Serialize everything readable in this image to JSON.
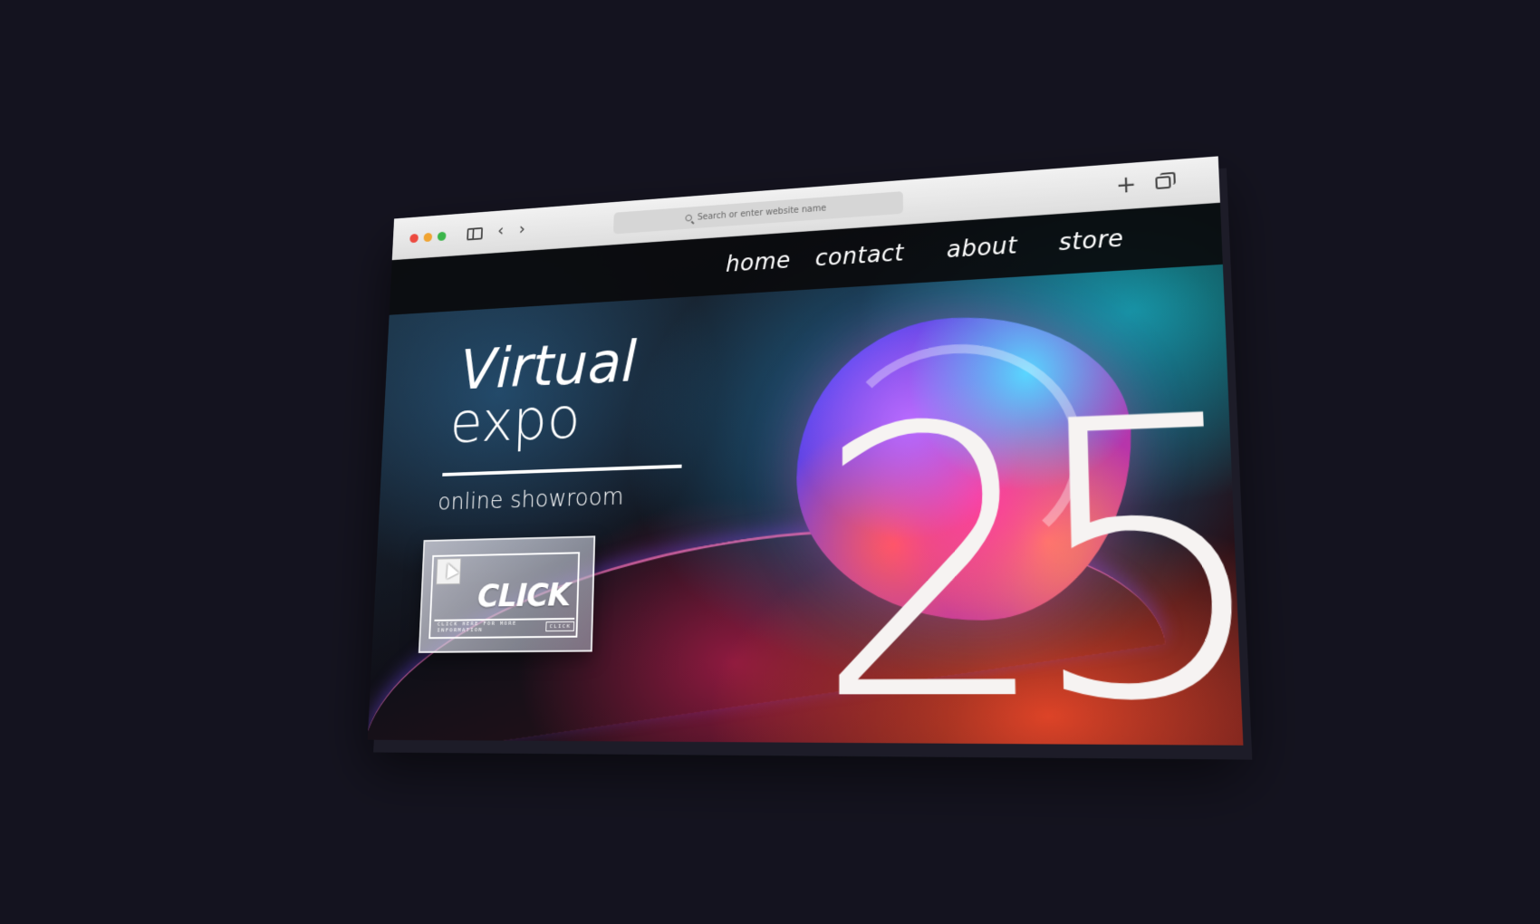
{
  "browser": {
    "url_placeholder": "Search or enter website name",
    "icons": [
      "sidebar-icon",
      "back-icon",
      "forward-icon",
      "search-icon",
      "new-tab-icon",
      "tabs-overview-icon"
    ]
  },
  "nav": {
    "home": "home",
    "contact": "contact",
    "about": "about",
    "store": "store"
  },
  "hero": {
    "title_line1": "Virtual",
    "title_line2": "expo",
    "subtitle": "online showroom",
    "number": "25"
  },
  "cta": {
    "label": "CLICK",
    "note": "CLICK HERE FOR MORE INFORMATION",
    "note_button": "CLICK"
  },
  "colors": {
    "background": "#14131f",
    "window_close": "#ec4a3f",
    "window_minimize": "#f0a432",
    "window_zoom": "#3bb54a"
  }
}
